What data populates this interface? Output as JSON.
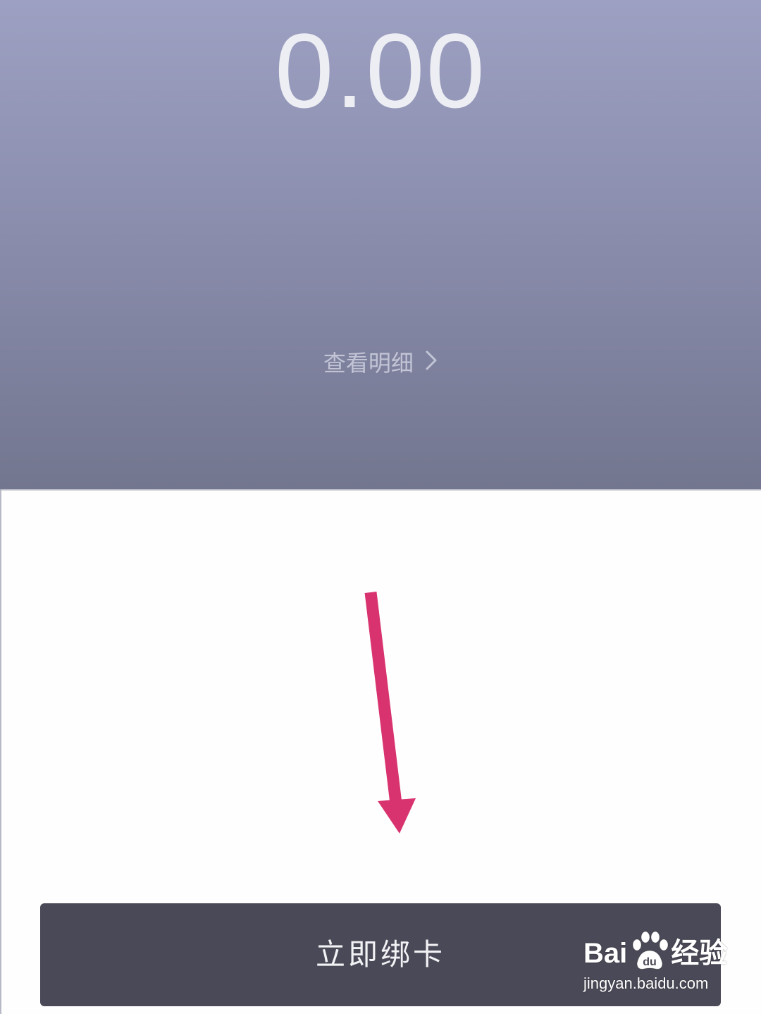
{
  "header": {
    "balance": "0.00",
    "detail_link": "查看明细",
    "chevron_icon": "chevron-right-icon"
  },
  "annotation": {
    "arrow_icon": "down-arrow-icon",
    "arrow_color": "#d9336f"
  },
  "actions": {
    "bind_card_label": "立即绑卡"
  },
  "watermark": {
    "brand_left": "Bai",
    "brand_right": "经验",
    "url": "jingyan.baidu.com"
  },
  "colors": {
    "header_top": "#9da0c2",
    "header_bottom": "#73768f",
    "button_bg": "#4a4957",
    "button_text": "#f2f2f5"
  }
}
